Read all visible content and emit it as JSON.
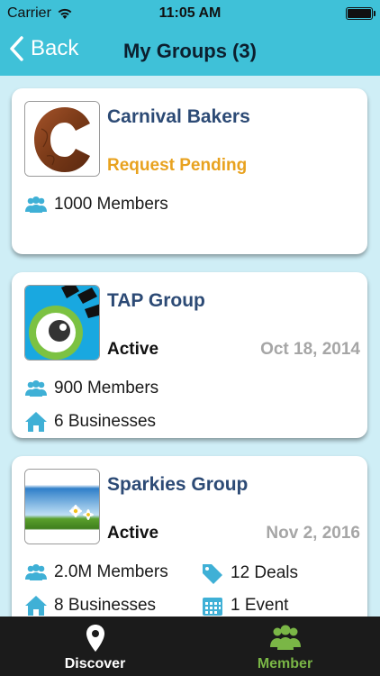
{
  "status_bar": {
    "carrier": "Carrier",
    "time": "11:05 AM"
  },
  "nav": {
    "back_label": "Back",
    "title": "My Groups (3)"
  },
  "groups": [
    {
      "name": "Carnival Bakers",
      "status": "Request Pending",
      "members": "1000 Members"
    },
    {
      "name": "TAP Group",
      "status": "Active",
      "date": "Oct 18, 2014",
      "members": "900 Members",
      "businesses": "6 Businesses"
    },
    {
      "name": "Sparkies Group",
      "status": "Active",
      "date": "Nov 2, 2016",
      "members": "2.0M Members",
      "businesses": "8 Businesses",
      "deals": "12 Deals",
      "events": "1 Event"
    }
  ],
  "tabs": [
    {
      "label": "Discover",
      "icon": "location-pin-icon",
      "selected": false
    },
    {
      "label": "Member",
      "icon": "group-icon",
      "selected": true
    }
  ],
  "colors": {
    "header": "#3fc1d8",
    "background": "#cfeef6",
    "group_name": "#2c4a75",
    "pending": "#e8a21f",
    "date": "#a6a6a6",
    "stat_icon": "#3fb0d6",
    "tab_active": "#7ab646",
    "tab_inactive": "#ffffff"
  }
}
